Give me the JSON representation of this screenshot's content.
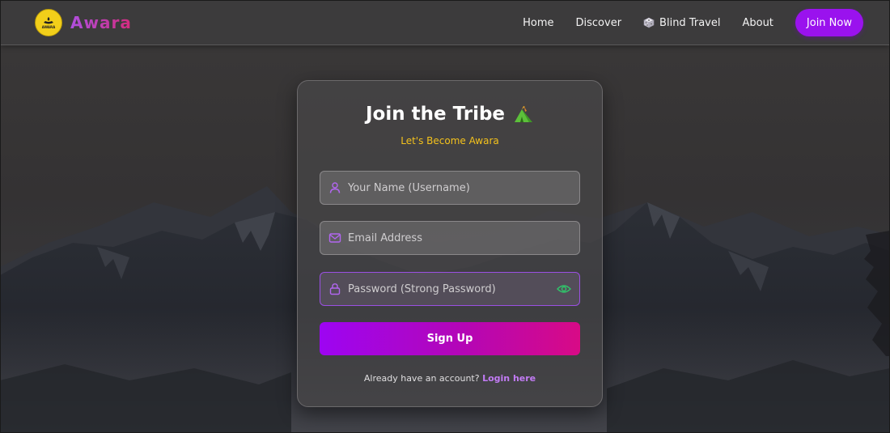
{
  "colors": {
    "accent_purple": "#9a12ee",
    "accent_pink": "#d80a86",
    "subtitle_yellow": "#f4c21c",
    "link_purple": "#c27bf4",
    "logo_yellow": "#f2cf1a"
  },
  "navbar": {
    "logo_text": "AWARA",
    "brand": "Awara",
    "links": [
      {
        "label": "Home"
      },
      {
        "label": "Discover"
      },
      {
        "label": "Blind Travel",
        "icon": "dice-icon"
      },
      {
        "label": "About"
      }
    ],
    "cta": "Join Now"
  },
  "card": {
    "title": "Join the Tribe",
    "title_icon": "tent-icon",
    "subtitle": "Let's Become Awara",
    "fields": {
      "username": {
        "placeholder": "Your Name (Username)",
        "icon": "user-icon"
      },
      "email": {
        "placeholder": "Email Address",
        "icon": "mail-icon"
      },
      "password": {
        "placeholder": "Password (Strong Password)",
        "icon": "lock-icon",
        "toggle_icon": "eye-icon"
      }
    },
    "submit": "Sign Up",
    "login_prompt": "Already have an account?",
    "login_link": "Login here"
  }
}
